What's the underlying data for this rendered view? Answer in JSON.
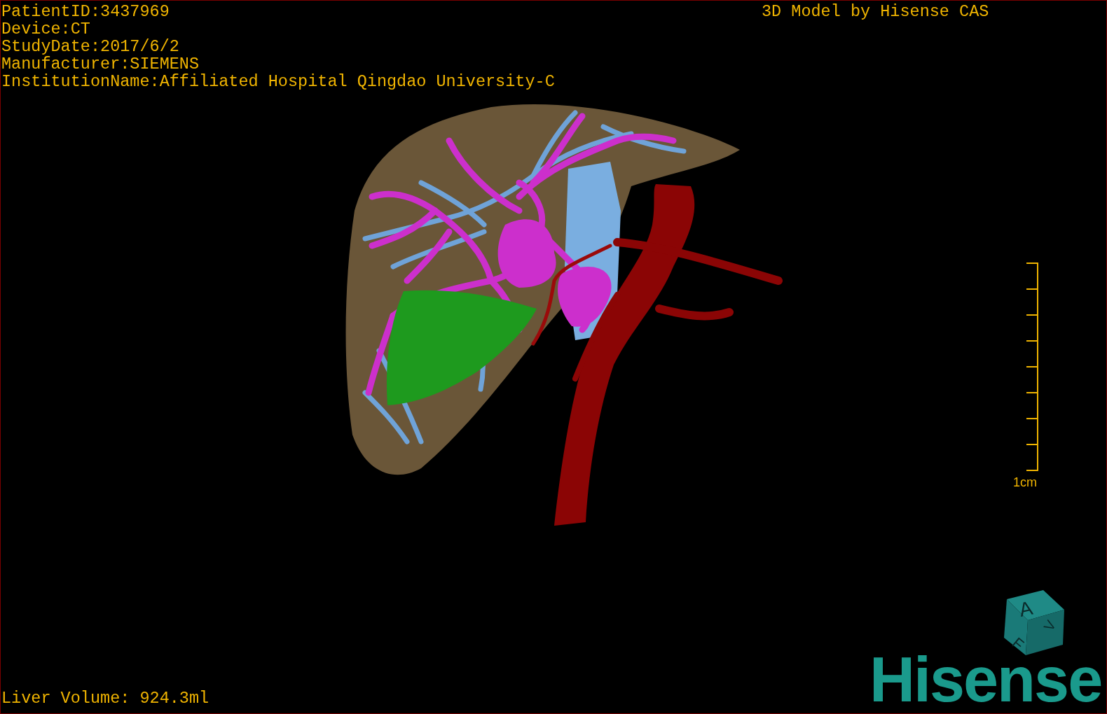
{
  "patient_info": [
    "PatientID:3437969",
    "Device:CT",
    "StudyDate:2017/6/2",
    "Manufacturer:SIEMENS",
    "InstitutionName:Affiliated Hospital Qingdao University-C"
  ],
  "title": "3D Model by Hisense CAS",
  "scale_bar": {
    "label": "1cm"
  },
  "orientation_cube": {
    "faces": [
      "A",
      "V",
      "F"
    ]
  },
  "logo": "Hisense",
  "liver_volume": "Liver Volume: 924.3ml"
}
